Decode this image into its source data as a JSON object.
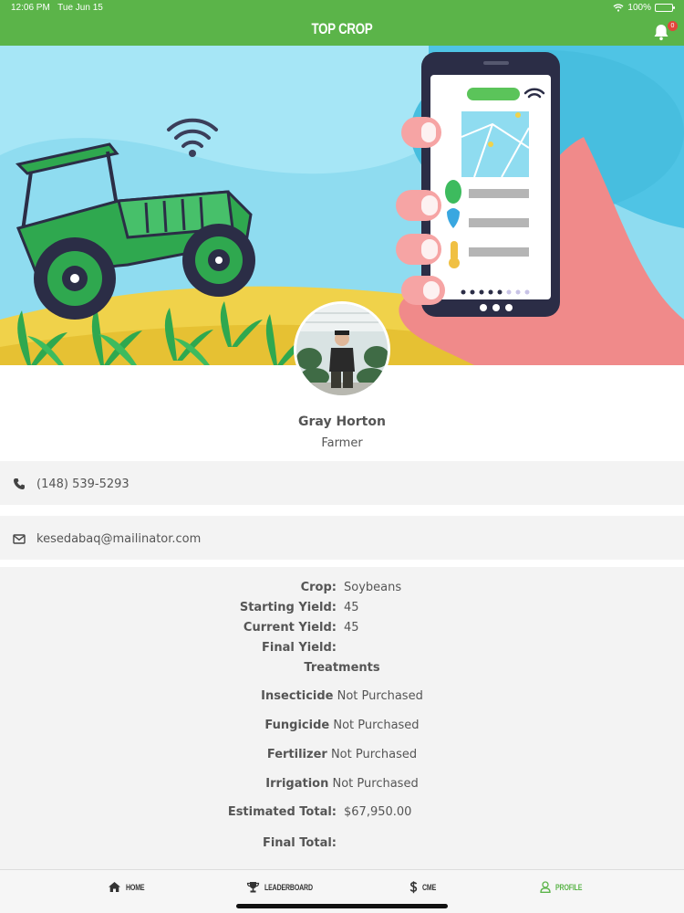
{
  "status": {
    "time": "12:06 PM",
    "date": "Tue Jun 15",
    "battery": "100%"
  },
  "header": {
    "title": "TOP CROP",
    "notifications": "0"
  },
  "profile": {
    "name": "Gray Horton",
    "role": "Farmer"
  },
  "contact": {
    "phone": "(148) 539-5293",
    "email": "kesedabaq@mailinator.com"
  },
  "details": {
    "crop_label": "Crop:",
    "crop_value": "Soybeans",
    "starting_label": "Starting Yield:",
    "starting_value": "45",
    "current_label": "Current Yield:",
    "current_value": "45",
    "final_yield_label": "Final Yield:",
    "treatments_heading": "Treatments",
    "treatments": [
      {
        "name": "Insecticide",
        "status": "Not Purchased"
      },
      {
        "name": "Fungicide",
        "status": "Not Purchased"
      },
      {
        "name": "Fertilizer",
        "status": "Not Purchased"
      },
      {
        "name": "Irrigation",
        "status": "Not Purchased"
      }
    ],
    "estimated_label": "Estimated Total:",
    "estimated_value": "$67,950.00",
    "final_total_label": "Final Total:"
  },
  "tabs": [
    {
      "label": "HOME",
      "icon": "home-icon"
    },
    {
      "label": "LEADERBOARD",
      "icon": "trophy-icon"
    },
    {
      "label": "CME",
      "icon": "dollar-icon"
    },
    {
      "label": "PROFILE",
      "icon": "user-icon"
    }
  ],
  "colors": {
    "brand_green": "#5bb449",
    "badge_red": "#e2453b",
    "text": "#555555"
  }
}
